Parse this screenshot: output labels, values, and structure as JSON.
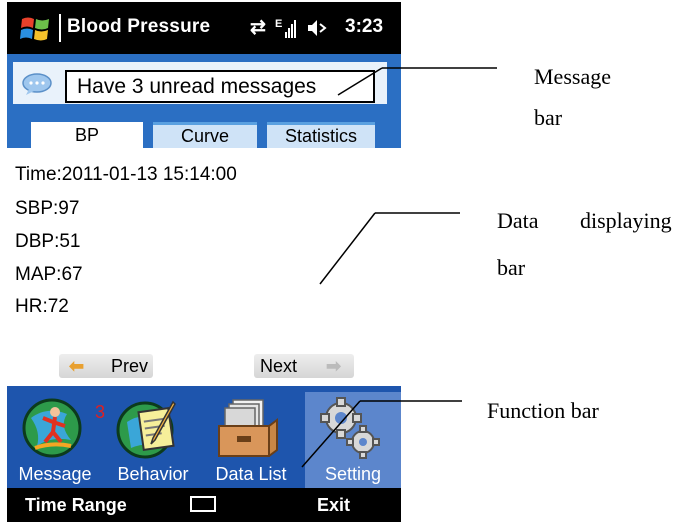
{
  "title_bar": {
    "app_title": "Blood Pressure",
    "time": "3:23"
  },
  "message_bar": {
    "text": "Have 3 unread messages"
  },
  "tabs": [
    {
      "label": "BP",
      "active": true
    },
    {
      "label": "Curve",
      "active": false
    },
    {
      "label": "Statistics",
      "active": false
    }
  ],
  "readings": {
    "time": "Time:2011-01-13 15:14:00",
    "sbp": "SBP:97",
    "dbp": "DBP:51",
    "map": "MAP:67",
    "hr": "HR:72"
  },
  "nav": {
    "prev_label": "Prev",
    "next_label": "Next"
  },
  "function_bar": {
    "items": [
      {
        "label": "Message",
        "icon": "message-icon"
      },
      {
        "label": "Behavior",
        "icon": "behavior-icon"
      },
      {
        "label": "Data List",
        "icon": "data-list-icon"
      },
      {
        "label": "Setting",
        "icon": "gear-icon"
      }
    ],
    "message_badge": "3"
  },
  "softkeys": {
    "left": "Time Range",
    "right": "Exit",
    "center_icon": "keyboard-icon"
  },
  "annotations": {
    "message_bar_l1": "Message",
    "message_bar_l2": "bar",
    "data_bar_l1a": "Data",
    "data_bar_l1b": "displaying",
    "data_bar_l2": "bar",
    "function_bar": "Function bar"
  },
  "colors": {
    "accent": "#2b6fc3",
    "function_bar": "#1e55ad",
    "badge": "#e02020"
  }
}
